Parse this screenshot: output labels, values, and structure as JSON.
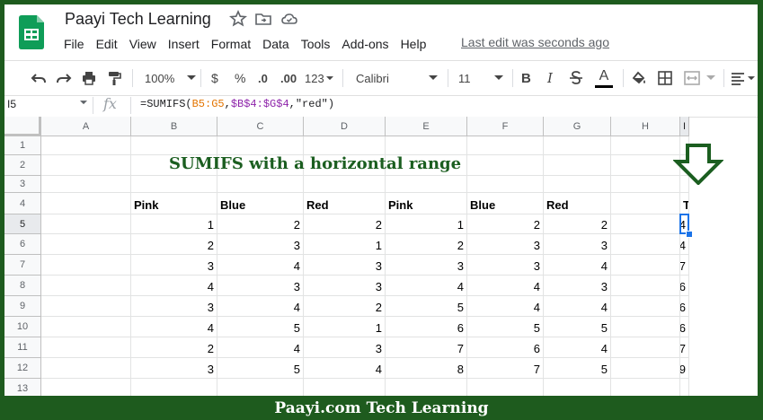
{
  "window": {
    "title": "Paayi Tech Learning",
    "last_edit": "Last edit was seconds ago"
  },
  "menu": [
    "File",
    "Edit",
    "View",
    "Insert",
    "Format",
    "Data",
    "Tools",
    "Add-ons",
    "Help"
  ],
  "toolbar": {
    "zoom": "100%",
    "currency": "$",
    "percent": "%",
    "decrease_decimal": ".0",
    "increase_decimal": ".00",
    "more_formats": "123",
    "font": "Calibri",
    "font_size": "11",
    "bold": "B",
    "italic": "I",
    "text_color": "A",
    "text_color_hex": "#000000"
  },
  "formula_bar": {
    "name_box": "I5",
    "fx": "fx",
    "formula_prefix": "=SUMIFS(",
    "formula_sum_range": "B5:G5",
    "formula_sep1": ",",
    "formula_criteria_range": "$B$4:$G$4",
    "formula_suffix": ",\"red\")"
  },
  "sheet": {
    "columns": [
      "A",
      "B",
      "C",
      "D",
      "E",
      "F",
      "G",
      "H",
      "I"
    ],
    "rows": [
      "1",
      "2",
      "3",
      "4",
      "5",
      "6",
      "7",
      "8",
      "9",
      "10",
      "11",
      "12",
      "13"
    ],
    "selected_column": "I",
    "selected_row": "5",
    "heading": "SUMIFS with a horizontal range",
    "headers": [
      "Pink",
      "Blue",
      "Red",
      "Pink",
      "Blue",
      "Red",
      "",
      "Total Red"
    ],
    "data": [
      [
        1,
        2,
        2,
        1,
        2,
        2,
        "",
        4
      ],
      [
        2,
        3,
        1,
        2,
        3,
        3,
        "",
        4
      ],
      [
        3,
        4,
        3,
        3,
        3,
        4,
        "",
        7
      ],
      [
        4,
        3,
        3,
        4,
        4,
        3,
        "",
        6
      ],
      [
        3,
        4,
        2,
        5,
        4,
        4,
        "",
        6
      ],
      [
        4,
        5,
        1,
        6,
        5,
        5,
        "",
        6
      ],
      [
        2,
        4,
        3,
        7,
        6,
        4,
        "",
        7
      ],
      [
        3,
        5,
        4,
        8,
        7,
        5,
        "",
        9
      ]
    ]
  },
  "colors": {
    "brand_green": "#1e5b1e",
    "heading_green": "#1b5e20",
    "selection_blue": "#1a73e8"
  },
  "footer": {
    "text": "Paayi.com Tech Learning"
  }
}
